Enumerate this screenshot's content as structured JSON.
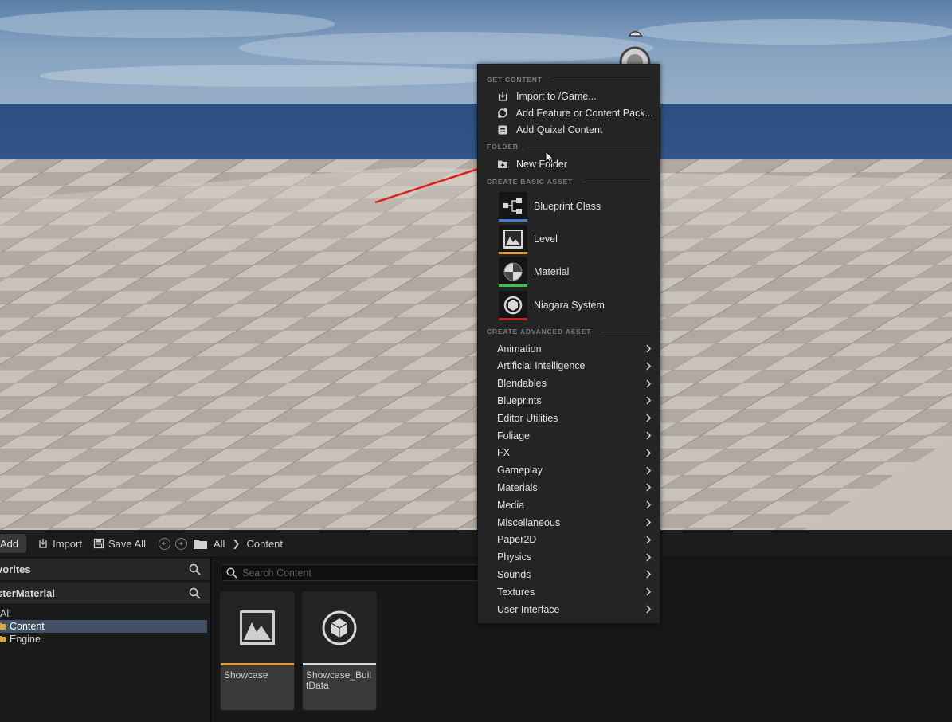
{
  "toolbar": {
    "add_label": "Add",
    "import_label": "Import",
    "save_all_label": "Save All",
    "breadcrumb": [
      "All",
      "Content"
    ]
  },
  "left_panel": {
    "favorites_label": "vorites",
    "project_label": "sterMaterial",
    "tree": [
      {
        "label": "All",
        "selected": false
      },
      {
        "label": "Content",
        "selected": true
      },
      {
        "label": "Engine",
        "selected": false
      }
    ]
  },
  "search": {
    "placeholder": "Search Content"
  },
  "assets": [
    {
      "label": "Showcase",
      "type": "level",
      "color": "#e39c3a"
    },
    {
      "label": "Showcase_BuiltData",
      "type": "data",
      "color": "#d8d8d8"
    }
  ],
  "context_menu": {
    "sections": {
      "get_content": "GET CONTENT",
      "folder": "FOLDER",
      "create_basic": "CREATE BASIC ASSET",
      "create_advanced": "CREATE ADVANCED ASSET"
    },
    "get_content_items": [
      {
        "label": "Import to /Game...",
        "icon": "import-icon"
      },
      {
        "label": "Add Feature or Content Pack...",
        "icon": "feature-pack-icon"
      },
      {
        "label": "Add Quixel Content",
        "icon": "quixel-icon"
      }
    ],
    "folder_items": [
      {
        "label": "New Folder",
        "icon": "new-folder-icon"
      }
    ],
    "basic_assets": [
      {
        "label": "Blueprint Class",
        "icon": "blueprint-class-icon",
        "color": "#3f7fd6"
      },
      {
        "label": "Level",
        "icon": "level-icon",
        "color": "#e39c3a"
      },
      {
        "label": "Material",
        "icon": "material-icon",
        "color": "#3fc24a"
      },
      {
        "label": "Niagara System",
        "icon": "niagara-icon",
        "color": "#c02222"
      }
    ],
    "advanced_assets": [
      "Animation",
      "Artificial Intelligence",
      "Blendables",
      "Blueprints",
      "Editor Utilities",
      "Foliage",
      "FX",
      "Gameplay",
      "Materials",
      "Media",
      "Miscellaneous",
      "Paper2D",
      "Physics",
      "Sounds",
      "Textures",
      "User Interface"
    ]
  },
  "colors": {
    "accent_selection": "#3f5163",
    "annotation_arrow": "#e02020"
  }
}
